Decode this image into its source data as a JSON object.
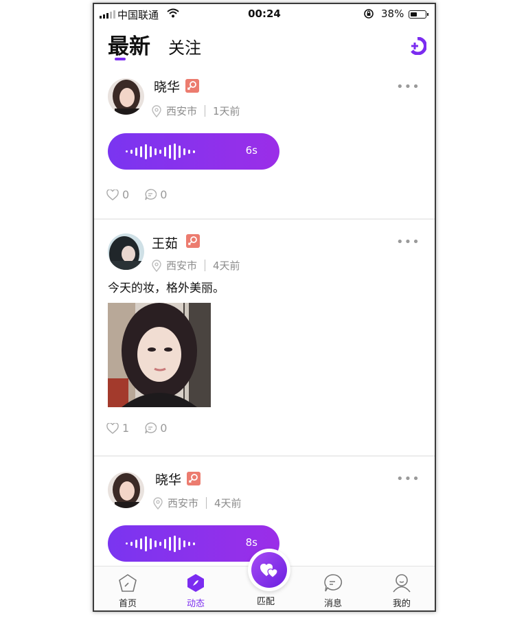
{
  "status_bar": {
    "carrier": "中国联通",
    "time": "00:24",
    "battery": "38%"
  },
  "header": {
    "tab_latest": "最新",
    "tab_follow": "关注"
  },
  "posts": [
    {
      "username": "晓华",
      "location": "西安市",
      "time_ago": "1天前",
      "voice_duration": "6s",
      "likes": "0",
      "comments": "0"
    },
    {
      "username": "王茹",
      "location": "西安市",
      "time_ago": "4天前",
      "text": "今天的妆，格外美丽。",
      "likes": "1",
      "comments": "0"
    },
    {
      "username": "晓华",
      "location": "西安市",
      "time_ago": "4天前",
      "voice_duration": "8s"
    }
  ],
  "tabbar": {
    "home": "首页",
    "moments": "动态",
    "match": "匹配",
    "messages": "消息",
    "mine": "我的"
  },
  "colors": {
    "accent": "#7b2cf0",
    "gender_badge": "#ec7c6f"
  },
  "icons": [
    "wifi-icon",
    "lock-rotation-icon",
    "battery-icon",
    "publish-icon",
    "female-icon",
    "location-pin-icon",
    "more-icon",
    "heart-icon",
    "comment-icon",
    "home-icon",
    "moments-icon",
    "match-hearts-icon",
    "message-icon",
    "profile-icon"
  ]
}
